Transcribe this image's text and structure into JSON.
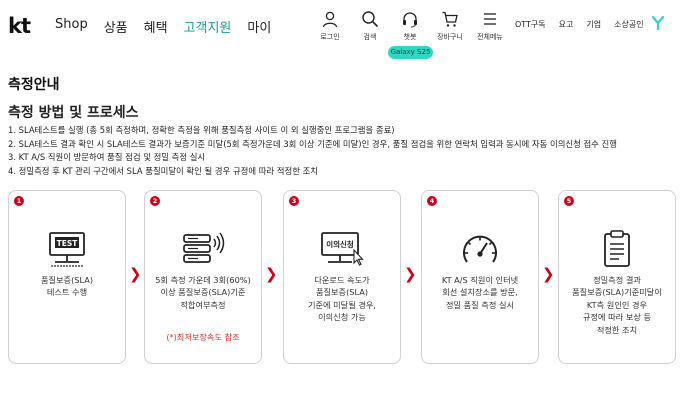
{
  "header": {
    "logo": "kt",
    "nav": [
      "Shop",
      "상품",
      "혜택",
      "고객지원",
      "마이"
    ],
    "util": [
      {
        "label": "로그인",
        "icon": "user-icon"
      },
      {
        "label": "검색",
        "icon": "search-icon"
      },
      {
        "label": "챗봇",
        "icon": "headset-icon"
      },
      {
        "label": "장바구니",
        "icon": "cart-icon"
      },
      {
        "label": "전체메뉴",
        "icon": "menu-icon"
      }
    ],
    "badge": "Galaxy S25",
    "right_links": [
      "OTT구독",
      "요고",
      "기업",
      "소상공인"
    ],
    "accent": "#1a9c8c",
    "badge_color": "#2ed8c3"
  },
  "main": {
    "title": "측정안내",
    "section_title": "측정 방법 및 프로세스",
    "steps": [
      "1. SLA테스트를 실행 (총 5회 측정하며, 정확한 측정을 위해 품질측정 사이트 이 외 실행중인 프로그램을 종료)",
      "2. SLA테스트 결과 확인 시 SLA테스트 결과가 보증기준 미달(5회 측정가운데 3회 이상 기준에 미달)인 경우, 품질 점검을 위한 연락처 입력과 동시에 자동 이의신청 접수 진행",
      "3. KT A/S 직원이 방문하여 품질 점검 및 정밀 측정 실시",
      "4. 정밀측정 후 KT 관리 구간에서 SLA 품질미달이 확인 될 경우 규정에 따라 적정한 조치"
    ],
    "cards": [
      {
        "num": "1",
        "lines": [
          "품질보증(SLA)",
          "테스트 수행"
        ],
        "icon": "test-monitor-icon",
        "icon_text": "TEST"
      },
      {
        "num": "2",
        "lines": [
          "5회 측정 가운데 3회(60%)",
          "이상 품질보증(SLA)기준",
          "적합여부측정"
        ],
        "note": "(*)최저보장속도 참조",
        "icon": "server-signal-icon"
      },
      {
        "num": "3",
        "lines": [
          "다운로드 속도가",
          "품질보증(SLA)",
          "기준에 미달될 경우,",
          "이의신청 가능"
        ],
        "icon": "objection-monitor-icon",
        "icon_text": "이의신청"
      },
      {
        "num": "4",
        "lines": [
          "KT A/S 직원이 인터넷",
          "회선 설치장소를 방문,",
          "정밀 품질 측정 실시"
        ],
        "icon": "speedometer-icon"
      },
      {
        "num": "5",
        "lines": [
          "정밀측정 결과",
          "품질보증(SLA)기준미달이",
          "KT측 원인인 경우",
          "규정에 따라 보상 등",
          "적정한 조치"
        ],
        "icon": "clipboard-icon"
      }
    ],
    "brand_red": "#d0021b"
  }
}
